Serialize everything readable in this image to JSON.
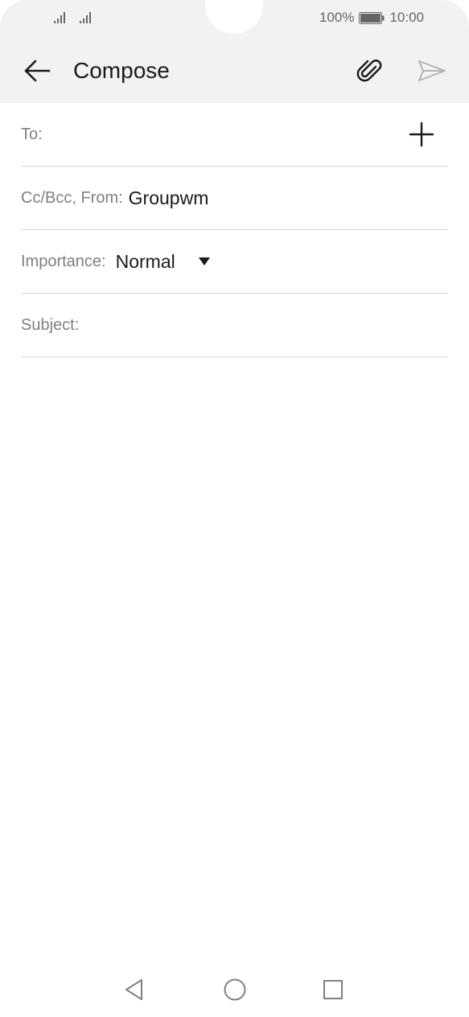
{
  "status_bar": {
    "battery_percent": "100%",
    "time": "10:00",
    "signal_bars": 2
  },
  "app_bar": {
    "title": "Compose",
    "back_icon": "arrow-left-icon",
    "attach_icon": "paperclip-icon",
    "send_icon": "send-icon"
  },
  "form": {
    "to_label": "To:",
    "to_value": "",
    "add_recipient_icon": "plus-icon",
    "cc_bcc_from_label": "Cc/Bcc, From:",
    "from_value": "Groupwm",
    "importance_label": "Importance:",
    "importance_value": "Normal",
    "subject_label": "Subject:",
    "subject_value": ""
  },
  "nav_bar": {
    "back_icon": "triangle-back-icon",
    "home_icon": "circle-home-icon",
    "recents_icon": "square-recents-icon"
  },
  "colors": {
    "header_bg": "#f2f2f2",
    "divider": "#d9d9d9",
    "label_text": "#808080",
    "primary_text": "#1a1a1a",
    "send_disabled": "#b3b3b3"
  }
}
